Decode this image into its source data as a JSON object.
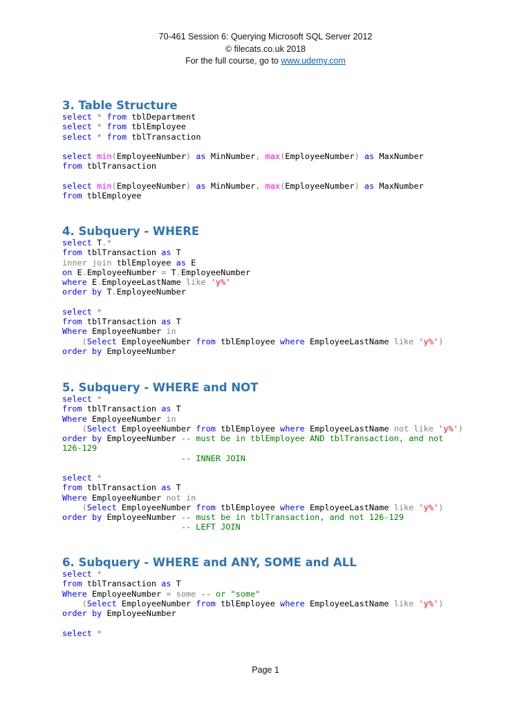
{
  "header": {
    "title": "70-461 Session 6: Querying Microsoft SQL Server 2012",
    "copyright": "© filecats.co.uk 2018",
    "course_prefix": "For the full course, go to ",
    "course_link": "www.udemy.com"
  },
  "colors": {
    "heading": "#2e74b5",
    "keyword": "#0000ff",
    "operator": "#808080",
    "function": "#ff00ff",
    "string": "#ff0000",
    "comment": "#008000"
  },
  "sections": [
    {
      "title": "3. Table Structure",
      "lines": [
        [
          [
            "k",
            "select"
          ],
          [
            "t",
            " "
          ],
          [
            "g",
            "*"
          ],
          [
            "t",
            " "
          ],
          [
            "k",
            "from"
          ],
          [
            "t",
            " tblDepartment"
          ]
        ],
        [
          [
            "k",
            "select"
          ],
          [
            "t",
            " "
          ],
          [
            "g",
            "*"
          ],
          [
            "t",
            " "
          ],
          [
            "k",
            "from"
          ],
          [
            "t",
            " tblEmployee"
          ]
        ],
        [
          [
            "k",
            "select"
          ],
          [
            "t",
            " "
          ],
          [
            "g",
            "*"
          ],
          [
            "t",
            " "
          ],
          [
            "k",
            "from"
          ],
          [
            "t",
            " tblTransaction"
          ]
        ],
        [],
        [
          [
            "k",
            "select"
          ],
          [
            "t",
            " "
          ],
          [
            "f",
            "min"
          ],
          [
            "g",
            "("
          ],
          [
            "t",
            "EmployeeNumber"
          ],
          [
            "g",
            ")"
          ],
          [
            "t",
            " "
          ],
          [
            "k",
            "as"
          ],
          [
            "t",
            " MinNumber"
          ],
          [
            "g",
            ","
          ],
          [
            "t",
            " "
          ],
          [
            "f",
            "max"
          ],
          [
            "g",
            "("
          ],
          [
            "t",
            "EmployeeNumber"
          ],
          [
            "g",
            ")"
          ],
          [
            "t",
            " "
          ],
          [
            "k",
            "as"
          ],
          [
            "t",
            " MaxNumber"
          ]
        ],
        [
          [
            "k",
            "from"
          ],
          [
            "t",
            " tblTransaction"
          ]
        ],
        [],
        [
          [
            "k",
            "select"
          ],
          [
            "t",
            " "
          ],
          [
            "f",
            "min"
          ],
          [
            "g",
            "("
          ],
          [
            "t",
            "EmployeeNumber"
          ],
          [
            "g",
            ")"
          ],
          [
            "t",
            " "
          ],
          [
            "k",
            "as"
          ],
          [
            "t",
            " MinNumber"
          ],
          [
            "g",
            ","
          ],
          [
            "t",
            " "
          ],
          [
            "f",
            "max"
          ],
          [
            "g",
            "("
          ],
          [
            "t",
            "EmployeeNumber"
          ],
          [
            "g",
            ")"
          ],
          [
            "t",
            " "
          ],
          [
            "k",
            "as"
          ],
          [
            "t",
            " MaxNumber"
          ]
        ],
        [
          [
            "k",
            "from"
          ],
          [
            "t",
            " tblEmployee"
          ]
        ]
      ]
    },
    {
      "title": "4. Subquery - WHERE",
      "lines": [
        [
          [
            "k",
            "select"
          ],
          [
            "t",
            " T"
          ],
          [
            "g",
            ".*"
          ]
        ],
        [
          [
            "k",
            "from"
          ],
          [
            "t",
            " tblTransaction "
          ],
          [
            "k",
            "as"
          ],
          [
            "t",
            " T"
          ]
        ],
        [
          [
            "g",
            "inner join"
          ],
          [
            "t",
            " tblEmployee "
          ],
          [
            "k",
            "as"
          ],
          [
            "t",
            " E"
          ]
        ],
        [
          [
            "k",
            "on"
          ],
          [
            "t",
            " E"
          ],
          [
            "g",
            "."
          ],
          [
            "t",
            "EmployeeNumber "
          ],
          [
            "g",
            "="
          ],
          [
            "t",
            " T"
          ],
          [
            "g",
            "."
          ],
          [
            "t",
            "EmployeeNumber"
          ]
        ],
        [
          [
            "k",
            "where"
          ],
          [
            "t",
            " E"
          ],
          [
            "g",
            "."
          ],
          [
            "t",
            "EmployeeLastName "
          ],
          [
            "g",
            "like"
          ],
          [
            "t",
            " "
          ],
          [
            "s",
            "'y%'"
          ]
        ],
        [
          [
            "k",
            "order by"
          ],
          [
            "t",
            " T"
          ],
          [
            "g",
            "."
          ],
          [
            "t",
            "EmployeeNumber"
          ]
        ],
        [],
        [
          [
            "k",
            "select"
          ],
          [
            "t",
            " "
          ],
          [
            "g",
            "*"
          ]
        ],
        [
          [
            "k",
            "from"
          ],
          [
            "t",
            " tblTransaction "
          ],
          [
            "k",
            "as"
          ],
          [
            "t",
            " T"
          ]
        ],
        [
          [
            "k",
            "Where"
          ],
          [
            "t",
            " EmployeeNumber "
          ],
          [
            "g",
            "in"
          ]
        ],
        [
          [
            "t",
            "    "
          ],
          [
            "g",
            "("
          ],
          [
            "k",
            "Select"
          ],
          [
            "t",
            " EmployeeNumber "
          ],
          [
            "k",
            "from"
          ],
          [
            "t",
            " tblEmployee "
          ],
          [
            "k",
            "where"
          ],
          [
            "t",
            " EmployeeLastName "
          ],
          [
            "g",
            "like"
          ],
          [
            "t",
            " "
          ],
          [
            "s",
            "'y%'"
          ],
          [
            "g",
            ")"
          ]
        ],
        [
          [
            "k",
            "order by"
          ],
          [
            "t",
            " EmployeeNumber"
          ]
        ]
      ]
    },
    {
      "title": "5. Subquery - WHERE and NOT",
      "lines": [
        [
          [
            "k",
            "select"
          ],
          [
            "t",
            " "
          ],
          [
            "g",
            "*"
          ]
        ],
        [
          [
            "k",
            "from"
          ],
          [
            "t",
            " tblTransaction "
          ],
          [
            "k",
            "as"
          ],
          [
            "t",
            " T"
          ]
        ],
        [
          [
            "k",
            "Where"
          ],
          [
            "t",
            " EmployeeNumber "
          ],
          [
            "g",
            "in"
          ]
        ],
        [
          [
            "t",
            "    "
          ],
          [
            "g",
            "("
          ],
          [
            "k",
            "Select"
          ],
          [
            "t",
            " EmployeeNumber "
          ],
          [
            "k",
            "from"
          ],
          [
            "t",
            " tblEmployee "
          ],
          [
            "k",
            "where"
          ],
          [
            "t",
            " EmployeeLastName "
          ],
          [
            "g",
            "not like"
          ],
          [
            "t",
            " "
          ],
          [
            "s",
            "'y%'"
          ],
          [
            "g",
            ")"
          ]
        ],
        [
          [
            "k",
            "order by"
          ],
          [
            "t",
            " EmployeeNumber "
          ],
          [
            "c",
            "-- must be in tblEmployee AND tblTransaction, and not"
          ]
        ],
        [
          [
            "c",
            "126-129"
          ]
        ],
        [
          [
            "t",
            "                        "
          ],
          [
            "c",
            "-- INNER JOIN"
          ]
        ],
        [],
        [
          [
            "k",
            "select"
          ],
          [
            "t",
            " "
          ],
          [
            "g",
            "*"
          ]
        ],
        [
          [
            "k",
            "from"
          ],
          [
            "t",
            " tblTransaction "
          ],
          [
            "k",
            "as"
          ],
          [
            "t",
            " T"
          ]
        ],
        [
          [
            "k",
            "Where"
          ],
          [
            "t",
            " EmployeeNumber "
          ],
          [
            "g",
            "not in"
          ]
        ],
        [
          [
            "t",
            "    "
          ],
          [
            "g",
            "("
          ],
          [
            "k",
            "Select"
          ],
          [
            "t",
            " EmployeeNumber "
          ],
          [
            "k",
            "from"
          ],
          [
            "t",
            " tblEmployee "
          ],
          [
            "k",
            "where"
          ],
          [
            "t",
            " EmployeeLastName "
          ],
          [
            "g",
            "like"
          ],
          [
            "t",
            " "
          ],
          [
            "s",
            "'y%'"
          ],
          [
            "g",
            ")"
          ]
        ],
        [
          [
            "k",
            "order by"
          ],
          [
            "t",
            " EmployeeNumber "
          ],
          [
            "c",
            "-- must be in tblTransaction, and not 126-129"
          ]
        ],
        [
          [
            "t",
            "                        "
          ],
          [
            "c",
            "-- LEFT JOIN"
          ]
        ]
      ]
    },
    {
      "title": "6. Subquery - WHERE and ANY, SOME and ALL",
      "lines": [
        [
          [
            "k",
            "select"
          ],
          [
            "t",
            " "
          ],
          [
            "g",
            "*"
          ]
        ],
        [
          [
            "k",
            "from"
          ],
          [
            "t",
            " tblTransaction "
          ],
          [
            "k",
            "as"
          ],
          [
            "t",
            " T"
          ]
        ],
        [
          [
            "k",
            "Where"
          ],
          [
            "t",
            " EmployeeNumber "
          ],
          [
            "g",
            "="
          ],
          [
            "t",
            " "
          ],
          [
            "g",
            "some"
          ],
          [
            "t",
            " "
          ],
          [
            "c",
            "-- or \"some\""
          ]
        ],
        [
          [
            "t",
            "    "
          ],
          [
            "g",
            "("
          ],
          [
            "k",
            "Select"
          ],
          [
            "t",
            " EmployeeNumber "
          ],
          [
            "k",
            "from"
          ],
          [
            "t",
            " tblEmployee "
          ],
          [
            "k",
            "where"
          ],
          [
            "t",
            " EmployeeLastName "
          ],
          [
            "g",
            "like"
          ],
          [
            "t",
            " "
          ],
          [
            "s",
            "'y%'"
          ],
          [
            "g",
            ")"
          ]
        ],
        [
          [
            "k",
            "order by"
          ],
          [
            "t",
            " EmployeeNumber"
          ]
        ],
        [],
        [
          [
            "k",
            "select"
          ],
          [
            "t",
            " "
          ],
          [
            "g",
            "*"
          ]
        ]
      ]
    }
  ],
  "footer": {
    "page": "Page 1"
  }
}
